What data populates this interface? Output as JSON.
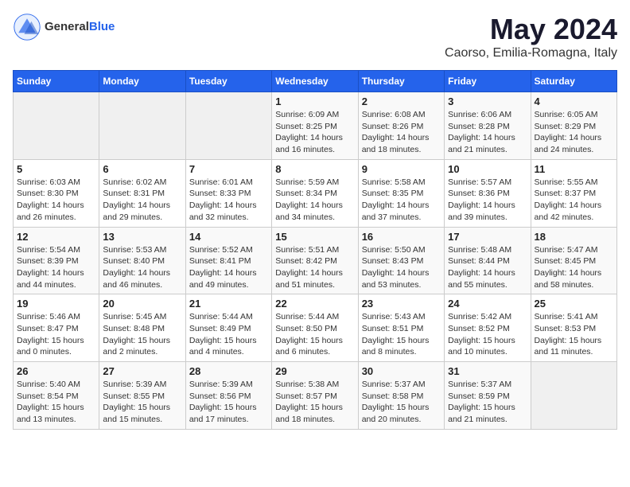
{
  "header": {
    "logo_general": "General",
    "logo_blue": "Blue",
    "title": "May 2024",
    "subtitle": "Caorso, Emilia-Romagna, Italy"
  },
  "weekdays": [
    "Sunday",
    "Monday",
    "Tuesday",
    "Wednesday",
    "Thursday",
    "Friday",
    "Saturday"
  ],
  "weeks": [
    [
      {
        "day": "",
        "detail": ""
      },
      {
        "day": "",
        "detail": ""
      },
      {
        "day": "",
        "detail": ""
      },
      {
        "day": "1",
        "detail": "Sunrise: 6:09 AM\nSunset: 8:25 PM\nDaylight: 14 hours\nand 16 minutes."
      },
      {
        "day": "2",
        "detail": "Sunrise: 6:08 AM\nSunset: 8:26 PM\nDaylight: 14 hours\nand 18 minutes."
      },
      {
        "day": "3",
        "detail": "Sunrise: 6:06 AM\nSunset: 8:28 PM\nDaylight: 14 hours\nand 21 minutes."
      },
      {
        "day": "4",
        "detail": "Sunrise: 6:05 AM\nSunset: 8:29 PM\nDaylight: 14 hours\nand 24 minutes."
      }
    ],
    [
      {
        "day": "5",
        "detail": "Sunrise: 6:03 AM\nSunset: 8:30 PM\nDaylight: 14 hours\nand 26 minutes."
      },
      {
        "day": "6",
        "detail": "Sunrise: 6:02 AM\nSunset: 8:31 PM\nDaylight: 14 hours\nand 29 minutes."
      },
      {
        "day": "7",
        "detail": "Sunrise: 6:01 AM\nSunset: 8:33 PM\nDaylight: 14 hours\nand 32 minutes."
      },
      {
        "day": "8",
        "detail": "Sunrise: 5:59 AM\nSunset: 8:34 PM\nDaylight: 14 hours\nand 34 minutes."
      },
      {
        "day": "9",
        "detail": "Sunrise: 5:58 AM\nSunset: 8:35 PM\nDaylight: 14 hours\nand 37 minutes."
      },
      {
        "day": "10",
        "detail": "Sunrise: 5:57 AM\nSunset: 8:36 PM\nDaylight: 14 hours\nand 39 minutes."
      },
      {
        "day": "11",
        "detail": "Sunrise: 5:55 AM\nSunset: 8:37 PM\nDaylight: 14 hours\nand 42 minutes."
      }
    ],
    [
      {
        "day": "12",
        "detail": "Sunrise: 5:54 AM\nSunset: 8:39 PM\nDaylight: 14 hours\nand 44 minutes."
      },
      {
        "day": "13",
        "detail": "Sunrise: 5:53 AM\nSunset: 8:40 PM\nDaylight: 14 hours\nand 46 minutes."
      },
      {
        "day": "14",
        "detail": "Sunrise: 5:52 AM\nSunset: 8:41 PM\nDaylight: 14 hours\nand 49 minutes."
      },
      {
        "day": "15",
        "detail": "Sunrise: 5:51 AM\nSunset: 8:42 PM\nDaylight: 14 hours\nand 51 minutes."
      },
      {
        "day": "16",
        "detail": "Sunrise: 5:50 AM\nSunset: 8:43 PM\nDaylight: 14 hours\nand 53 minutes."
      },
      {
        "day": "17",
        "detail": "Sunrise: 5:48 AM\nSunset: 8:44 PM\nDaylight: 14 hours\nand 55 minutes."
      },
      {
        "day": "18",
        "detail": "Sunrise: 5:47 AM\nSunset: 8:45 PM\nDaylight: 14 hours\nand 58 minutes."
      }
    ],
    [
      {
        "day": "19",
        "detail": "Sunrise: 5:46 AM\nSunset: 8:47 PM\nDaylight: 15 hours\nand 0 minutes."
      },
      {
        "day": "20",
        "detail": "Sunrise: 5:45 AM\nSunset: 8:48 PM\nDaylight: 15 hours\nand 2 minutes."
      },
      {
        "day": "21",
        "detail": "Sunrise: 5:44 AM\nSunset: 8:49 PM\nDaylight: 15 hours\nand 4 minutes."
      },
      {
        "day": "22",
        "detail": "Sunrise: 5:44 AM\nSunset: 8:50 PM\nDaylight: 15 hours\nand 6 minutes."
      },
      {
        "day": "23",
        "detail": "Sunrise: 5:43 AM\nSunset: 8:51 PM\nDaylight: 15 hours\nand 8 minutes."
      },
      {
        "day": "24",
        "detail": "Sunrise: 5:42 AM\nSunset: 8:52 PM\nDaylight: 15 hours\nand 10 minutes."
      },
      {
        "day": "25",
        "detail": "Sunrise: 5:41 AM\nSunset: 8:53 PM\nDaylight: 15 hours\nand 11 minutes."
      }
    ],
    [
      {
        "day": "26",
        "detail": "Sunrise: 5:40 AM\nSunset: 8:54 PM\nDaylight: 15 hours\nand 13 minutes."
      },
      {
        "day": "27",
        "detail": "Sunrise: 5:39 AM\nSunset: 8:55 PM\nDaylight: 15 hours\nand 15 minutes."
      },
      {
        "day": "28",
        "detail": "Sunrise: 5:39 AM\nSunset: 8:56 PM\nDaylight: 15 hours\nand 17 minutes."
      },
      {
        "day": "29",
        "detail": "Sunrise: 5:38 AM\nSunset: 8:57 PM\nDaylight: 15 hours\nand 18 minutes."
      },
      {
        "day": "30",
        "detail": "Sunrise: 5:37 AM\nSunset: 8:58 PM\nDaylight: 15 hours\nand 20 minutes."
      },
      {
        "day": "31",
        "detail": "Sunrise: 5:37 AM\nSunset: 8:59 PM\nDaylight: 15 hours\nand 21 minutes."
      },
      {
        "day": "",
        "detail": ""
      }
    ]
  ]
}
